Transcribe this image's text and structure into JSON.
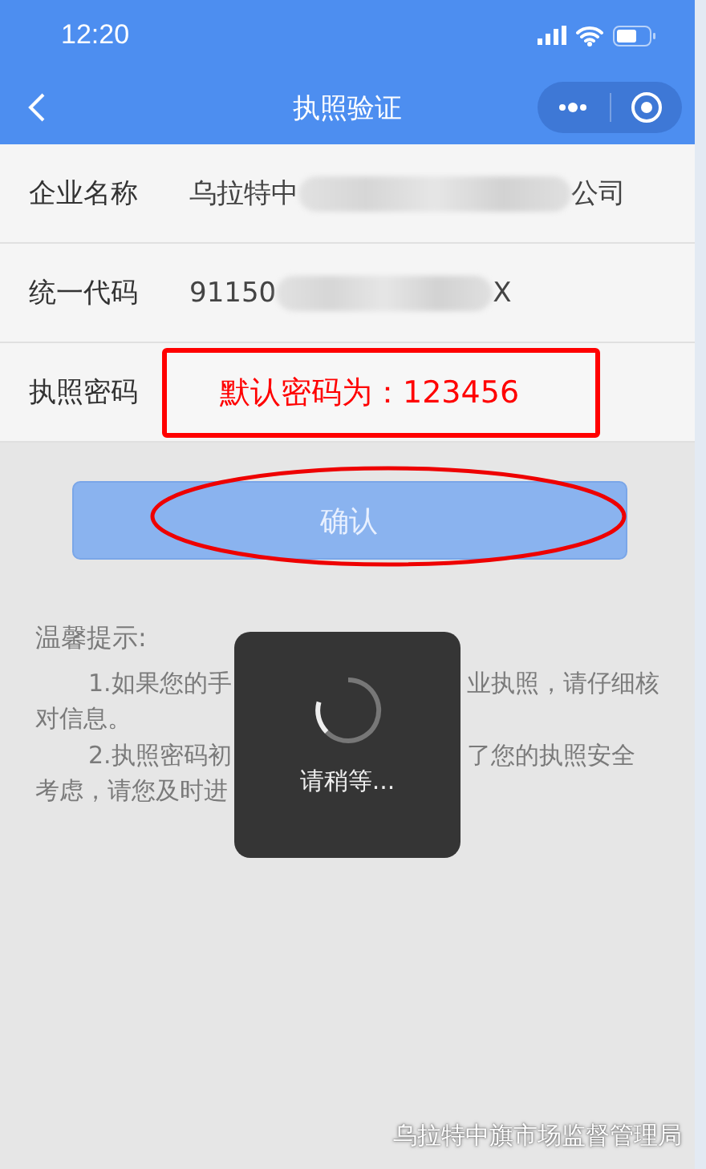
{
  "status_bar": {
    "time": "12:20"
  },
  "nav": {
    "title": "执照验证"
  },
  "rows": [
    {
      "label": "企业名称",
      "kind": "redacted",
      "value_start": "乌拉特中",
      "value_end": "公司"
    },
    {
      "label": "统一代码",
      "kind": "redacted",
      "value_start": "91150",
      "value_end": "X"
    },
    {
      "label": "执照密码",
      "kind": "annotation",
      "annotation": "默认密码为：123456"
    }
  ],
  "confirm_button": {
    "label": "确认",
    "annotated": true
  },
  "tips": {
    "title": "温馨提示:",
    "lines": [
      {
        "kind": "indent",
        "left": "1.如果您的手",
        "right": "业执照，请仔细核"
      },
      {
        "kind": "plain",
        "left": "对信息。"
      },
      {
        "kind": "indent",
        "left": "2.执照密码初",
        "right": "了您的执照安全"
      },
      {
        "kind": "plain",
        "left": "考虑，请您及时进"
      }
    ]
  },
  "toast": {
    "text": "请稍等..."
  },
  "footer": "乌拉特中旗市场监督管理局"
}
